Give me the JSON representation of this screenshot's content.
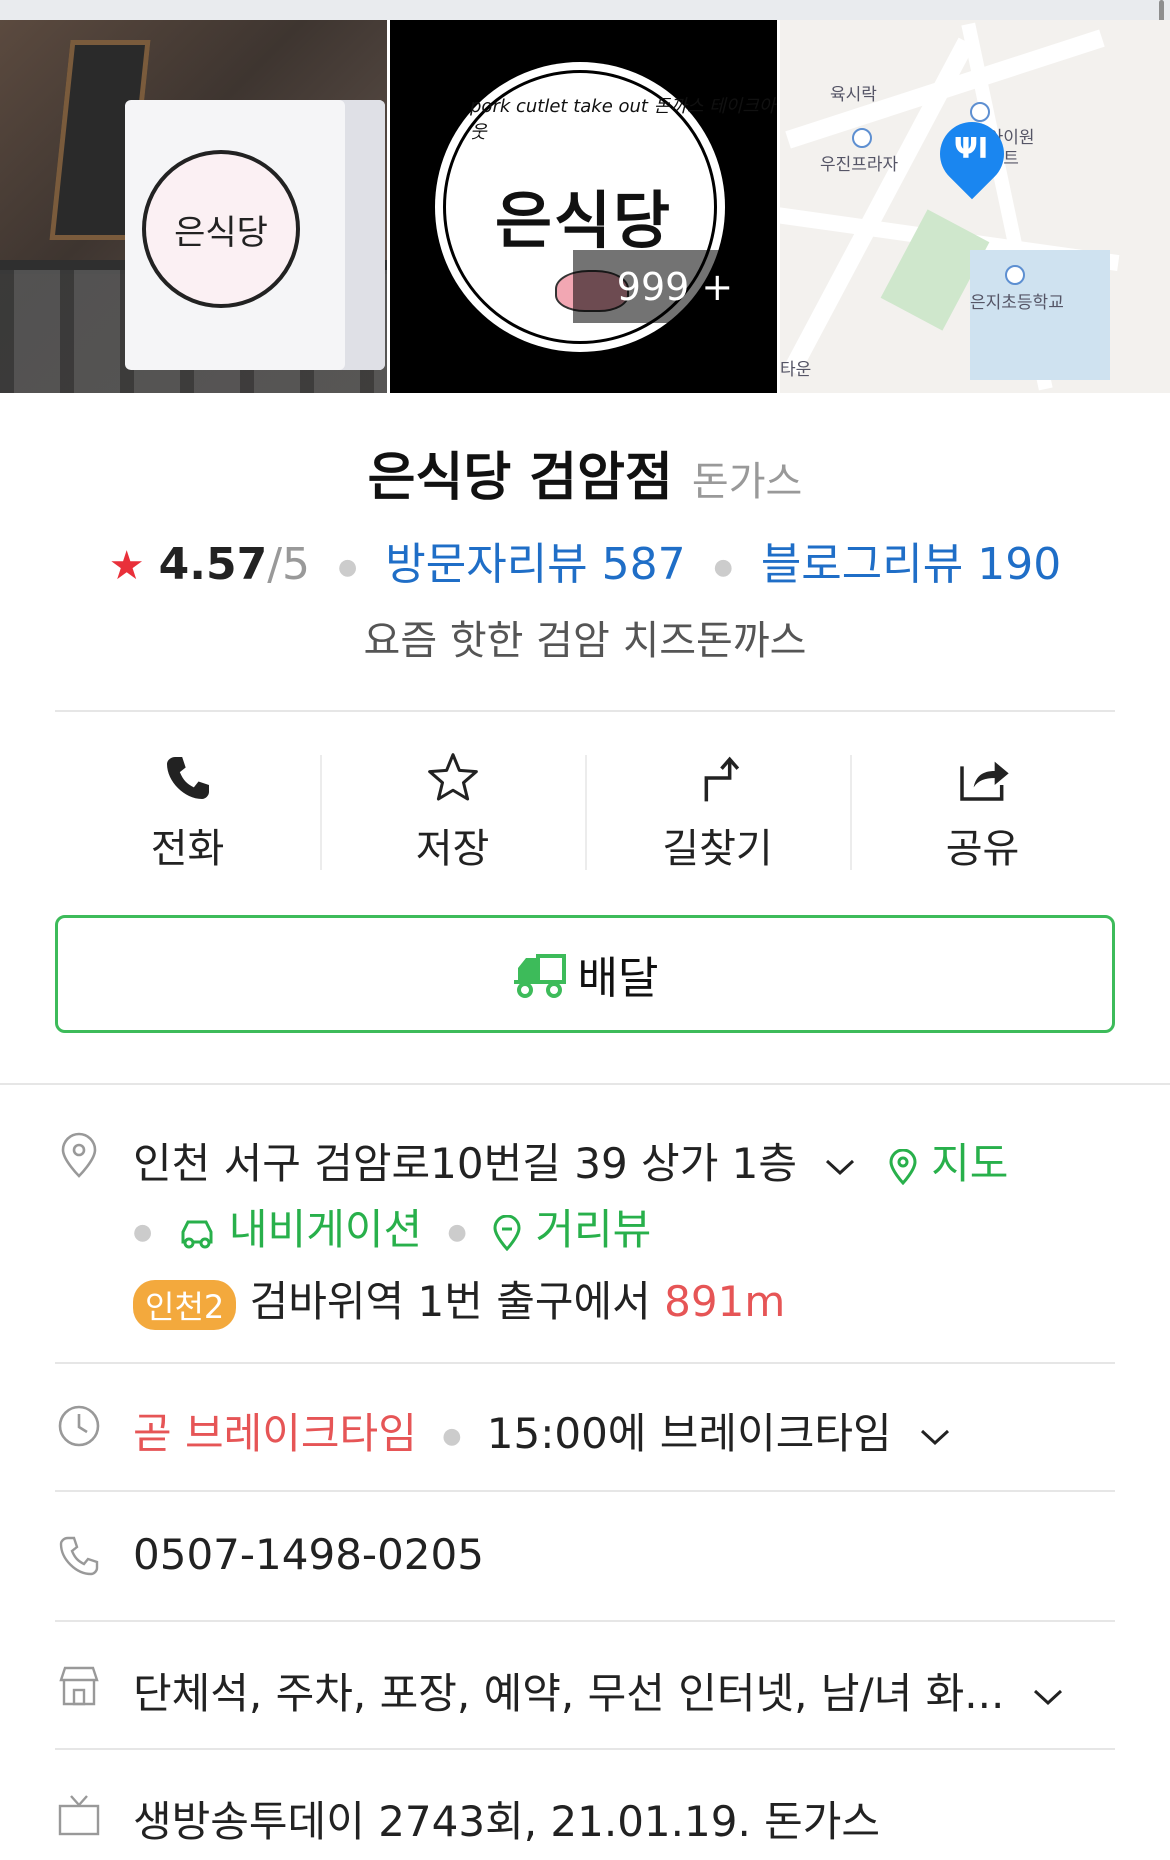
{
  "photos": {
    "count_badge": "999 +"
  },
  "map": {
    "labels": [
      "육시락",
      "우진프라자",
      "림아이원",
      "아파트",
      "은지초등학교",
      "타운"
    ]
  },
  "place": {
    "name": "은식당 검암점",
    "category": "돈가스",
    "rating": "4.57",
    "rating_max": "/5",
    "visitor_reviews": "방문자리뷰 587",
    "blog_reviews": "블로그리뷰 190",
    "description": "요즘 핫한 검암 치즈돈까스"
  },
  "logo": {
    "name": "은식당",
    "arc_text": "pork cutlet take out 돈까스 테이크아웃"
  },
  "actions": [
    {
      "label": "전화",
      "icon": "phone-icon"
    },
    {
      "label": "저장",
      "icon": "star-outline-icon"
    },
    {
      "label": "길찾기",
      "icon": "directions-icon"
    },
    {
      "label": "공유",
      "icon": "share-icon"
    }
  ],
  "delivery": {
    "label": "배달",
    "icon": "delivery-truck-icon",
    "color": "#3dbb5a"
  },
  "address": {
    "text": "인천 서구 검암로10번길 39 상가 1층",
    "map_link": "지도",
    "navigation_link": "내비게이션",
    "streetview_link": "거리뷰",
    "subway_line": "인천2",
    "subway_text": "검바위역 1번 출구에서",
    "subway_distance": "891m"
  },
  "hours": {
    "status": "곧 브레이크타임",
    "detail": "15:00에 브레이크타임"
  },
  "phone": {
    "number": "0507-1498-0205"
  },
  "amenities": {
    "text": "단체석, 주차, 포장, 예약, 무선 인터넷, 남/녀 화..."
  },
  "tv": {
    "text": "생방송투데이 2743회, 21.01.19. 돈가스"
  },
  "colors": {
    "link_blue": "#1f6ec7",
    "green": "#28b04b",
    "red": "#e65556",
    "star_red": "#e9303a",
    "subway_orange": "#f3a93d"
  }
}
